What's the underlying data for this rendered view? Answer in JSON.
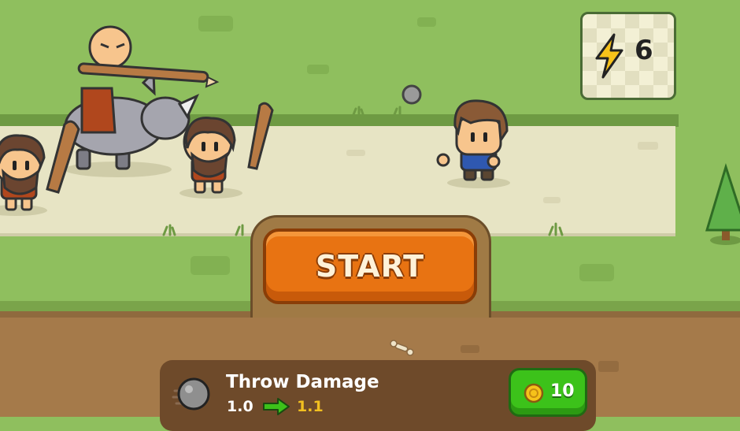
{
  "hud": {
    "energy": {
      "icon": "lightning-bolt-icon",
      "count": "6"
    }
  },
  "start_button": {
    "label": "START"
  },
  "upgrade_panel": {
    "icon": "stone-projectile-icon",
    "title": "Throw Damage",
    "current_value": "1.0",
    "next_value": "1.1",
    "arrow_icon": "green-arrow-right-icon",
    "cost": {
      "icon": "coin-icon",
      "amount": "10"
    }
  },
  "colors": {
    "grass": "#8fbf5e",
    "path": "#e7e4c4",
    "dirt": "#a57a4a",
    "start_button": "#e87312",
    "buy_button": "#3cc21a",
    "next_value": "#f2c020"
  }
}
